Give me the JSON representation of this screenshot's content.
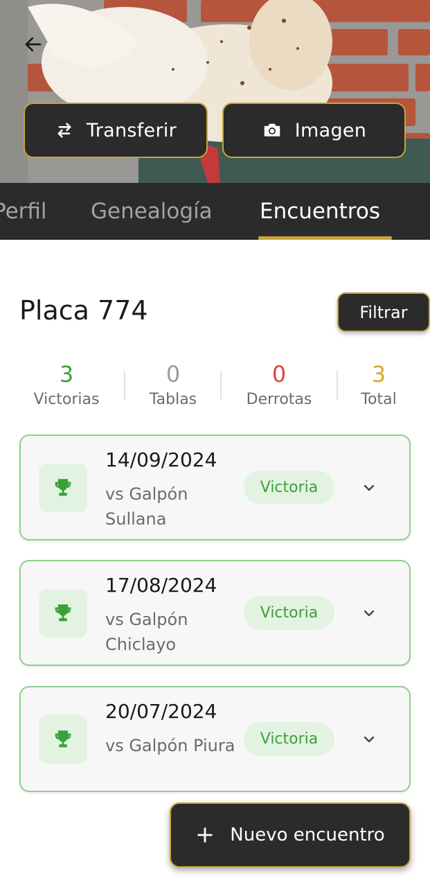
{
  "hero": {
    "transfer_label": "Transferir",
    "image_label": "Imagen"
  },
  "tabs": [
    {
      "label": "Perfil",
      "active": false
    },
    {
      "label": "Genealogía",
      "active": false
    },
    {
      "label": "Encuentros",
      "active": true
    }
  ],
  "header": {
    "title": "Placa 774",
    "filter_label": "Filtrar"
  },
  "stats": [
    {
      "value": "3",
      "label": "Victorias",
      "color": "#3aa13a"
    },
    {
      "value": "0",
      "label": "Tablas",
      "color": "#9a9a9a"
    },
    {
      "value": "0",
      "label": "Derrotas",
      "color": "#e0443a"
    },
    {
      "value": "3",
      "label": "Total",
      "color": "#d4a92a"
    }
  ],
  "encounters": [
    {
      "date": "14/09/2024",
      "opponent": "vs Galpón Sullana",
      "result": "Victoria"
    },
    {
      "date": "17/08/2024",
      "opponent": "vs Galpón Chiclayo",
      "result": "Victoria"
    },
    {
      "date": "20/07/2024",
      "opponent": "vs Galpón Piura",
      "result": "Victoria"
    }
  ],
  "fab": {
    "label": "Nuevo encuentro"
  },
  "colors": {
    "accent": "#c9a43a",
    "dark": "#2b2b2b",
    "success": "#3aa13a",
    "success_bg": "#e3f3e2",
    "card_border": "#8fcf8a"
  },
  "icons": {
    "back": "arrow-left-icon",
    "transfer": "swap-arrows-icon",
    "image": "camera-icon",
    "trophy": "trophy-icon",
    "expand": "chevron-down-icon",
    "add": "plus-icon"
  }
}
